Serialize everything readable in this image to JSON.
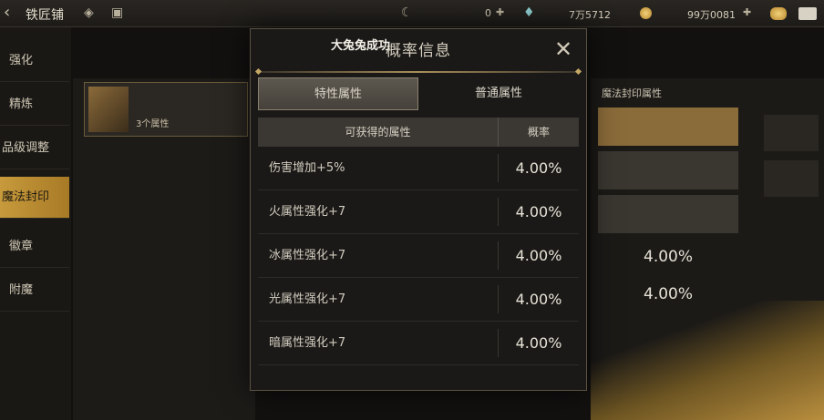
{
  "topbar": {
    "title": "铁匠铺",
    "resource1_value": "0",
    "resource2_value": "7万5712",
    "resource3_value": "99万0081"
  },
  "nav": {
    "items": [
      {
        "label": "强化"
      },
      {
        "label": "精炼"
      },
      {
        "label": "品级调整"
      },
      {
        "label": "魔法封印"
      },
      {
        "label": "徽章"
      },
      {
        "label": "附魔"
      }
    ],
    "active_index": 3
  },
  "background": {
    "item_sub": "3个属性",
    "right_header": "魔法封印属性",
    "pct_a": "4.00%",
    "pct_b": "4.00%"
  },
  "modal": {
    "title": "概率信息",
    "overlay_text": "大兔兔成功",
    "tabs": [
      {
        "label": "特性属性",
        "active": true
      },
      {
        "label": "普通属性",
        "active": false
      }
    ],
    "table": {
      "headers": [
        "可获得的属性",
        "概率"
      ],
      "rows": [
        {
          "attr": "伤害增加+5%",
          "rate": "4.00%"
        },
        {
          "attr": "火属性强化+7",
          "rate": "4.00%"
        },
        {
          "attr": "冰属性强化+7",
          "rate": "4.00%"
        },
        {
          "attr": "光属性强化+7",
          "rate": "4.00%"
        },
        {
          "attr": "暗属性强化+7",
          "rate": "4.00%"
        }
      ]
    }
  }
}
